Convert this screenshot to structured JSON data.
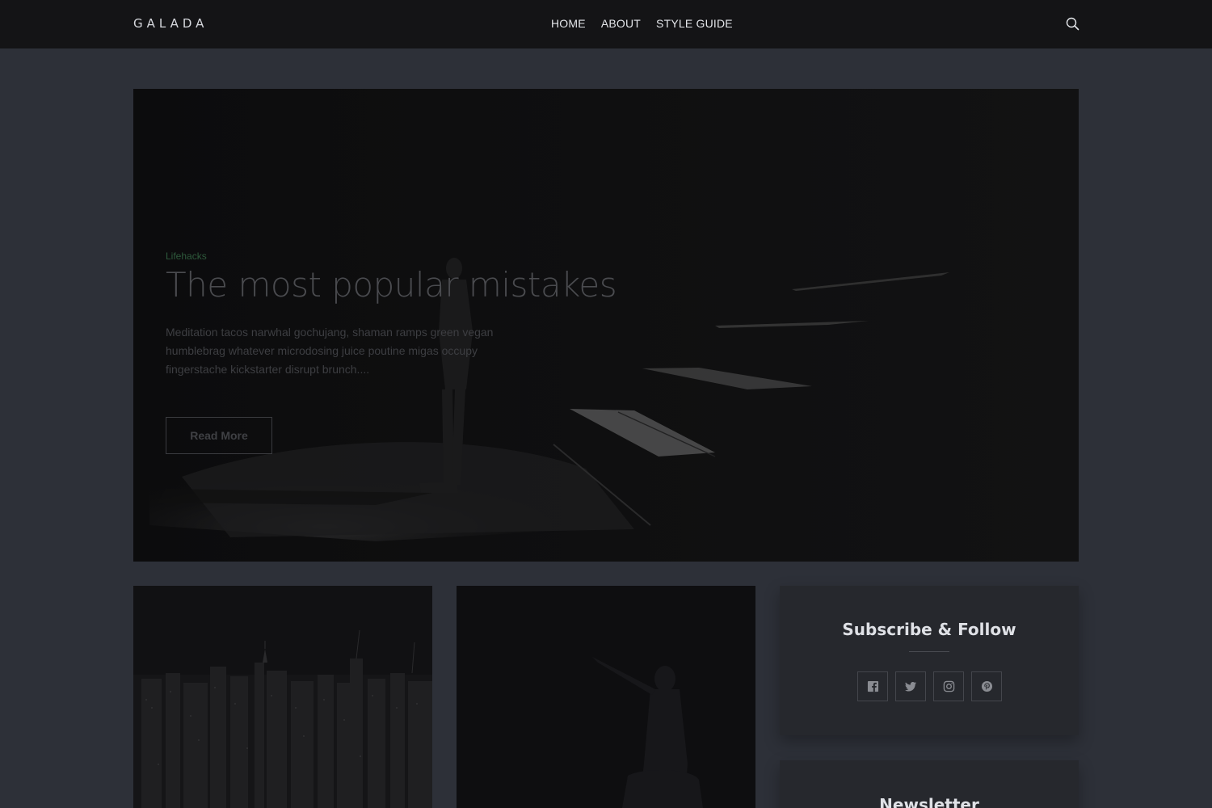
{
  "header": {
    "logo": "GALADA",
    "nav": [
      "HOME",
      "ABOUT",
      "STYLE GUIDE"
    ],
    "search_icon": "search-icon"
  },
  "hero": {
    "category": "Lifehacks",
    "title": "The most popular mistakes",
    "excerpt": "Meditation tacos narwhal gochujang, shaman ramps green vegan humblebrag whatever microdosing juice poutine migas occupy fingerstache kickstarter disrupt brunch....",
    "read_more": "Read More"
  },
  "sidebar": {
    "follow_title": "Subscribe & Follow",
    "socials": [
      "facebook-icon",
      "twitter-icon",
      "instagram-icon",
      "pinterest-icon"
    ],
    "newsletter_title": "Newsletter"
  }
}
